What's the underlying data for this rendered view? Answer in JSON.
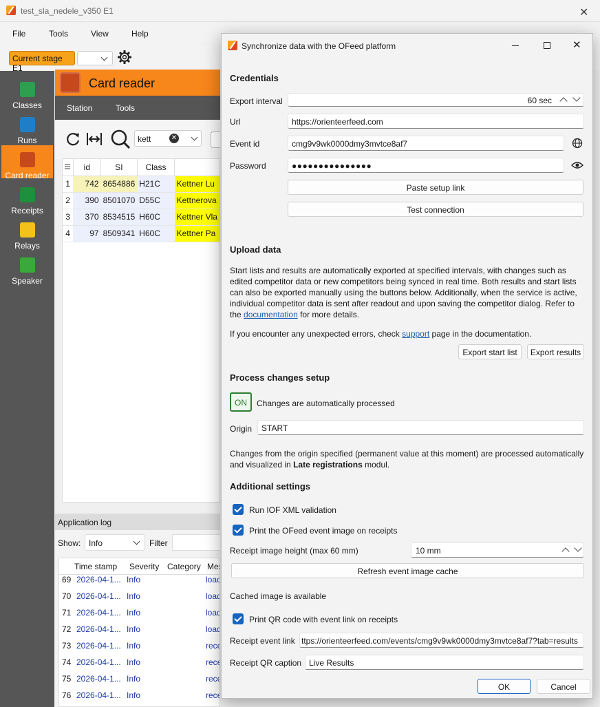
{
  "window": {
    "title": "test_sla_nedele_v350 E1"
  },
  "menu": {
    "file": "File",
    "tools": "Tools",
    "view": "View",
    "help": "Help"
  },
  "toolbar": {
    "stage_label": "Current stage E1"
  },
  "sidebar": {
    "items": [
      {
        "label": "Classes",
        "icon": "table-icon",
        "color": "#2e9e4f"
      },
      {
        "label": "Runs",
        "icon": "runner-icon",
        "color": "#1e7fc8"
      },
      {
        "label": "Card reader",
        "icon": "card-reader-icon",
        "color": "#c6491d"
      },
      {
        "label": "Receipts",
        "icon": "printer-icon",
        "color": "#1e8f3a"
      },
      {
        "label": "Relays",
        "icon": "relay-icon",
        "color": "#f2c11b"
      },
      {
        "label": "Speaker",
        "icon": "microphone-icon",
        "color": "#3aa83a"
      }
    ]
  },
  "card_reader": {
    "title": "Card reader",
    "tabs": {
      "station": "Station",
      "tools": "Tools"
    },
    "search_value": "kett",
    "columns": {
      "id": "id",
      "si": "SI",
      "class": "Class"
    },
    "rows": [
      {
        "n": "1",
        "id": "742",
        "si": "8654886",
        "class": "H21C",
        "name": "Kettner Lu"
      },
      {
        "n": "2",
        "id": "390",
        "si": "8501070",
        "class": "D55C",
        "name": "Kettnerova"
      },
      {
        "n": "3",
        "id": "370",
        "si": "8534515",
        "class": "H60C",
        "name": "Kettner Vla"
      },
      {
        "n": "4",
        "id": "97",
        "si": "8509341",
        "class": "H60C",
        "name": "Kettner Pa"
      }
    ]
  },
  "app_log": {
    "title": "Application log",
    "show_label": "Show:",
    "show_value": "Info",
    "filter_label": "Filter",
    "columns": {
      "time": "Time stamp",
      "severity": "Severity",
      "category": "Category",
      "message": "Mes"
    },
    "rows": [
      {
        "n": "69",
        "time": "2026-04-1...",
        "severity": "Info",
        "msg": "load"
      },
      {
        "n": "70",
        "time": "2026-04-1...",
        "severity": "Info",
        "msg": "load"
      },
      {
        "n": "71",
        "time": "2026-04-1...",
        "severity": "Info",
        "msg": "load"
      },
      {
        "n": "72",
        "time": "2026-04-1...",
        "severity": "Info",
        "msg": "load"
      },
      {
        "n": "73",
        "time": "2026-04-1...",
        "severity": "Info",
        "msg": "rece"
      },
      {
        "n": "74",
        "time": "2026-04-1...",
        "severity": "Info",
        "msg": "rece"
      },
      {
        "n": "75",
        "time": "2026-04-1...",
        "severity": "Info",
        "msg": "rece"
      },
      {
        "n": "76",
        "time": "2026-04-1...",
        "severity": "Info",
        "msg": "rece"
      }
    ]
  },
  "dialog": {
    "title": "Synchronize data with the OFeed platform",
    "credentials": {
      "heading": "Credentials",
      "export_interval_label": "Export interval",
      "export_interval_value": "60 sec",
      "url_label": "Url",
      "url_value": "https://orienteerfeed.com",
      "event_id_label": "Event id",
      "event_id_value": "cmg9v9wk0000dmy3mvtce8af7",
      "password_label": "Password",
      "password_value": "●●●●●●●●●●●●●●●",
      "paste_button": "Paste setup link",
      "test_button": "Test connection"
    },
    "upload": {
      "heading": "Upload data",
      "para1": "Start lists and results are automatically exported at specified intervals, with changes such as edited competitor data or new competitors being synced in real time. Both results and start lists can also be exported manually using the buttons below. Additionally, when the service is active, individual competitor data is sent after readout and upon saving the competitor dialog. Refer to the ",
      "para1_link": "documentation",
      "para1_end": " for more details.",
      "para2": "If you encounter any unexpected errors, check ",
      "para2_link": "support",
      "para2_end": " page in the documentation.",
      "export_start_button": "Export start list",
      "export_results_button": "Export results"
    },
    "process": {
      "heading": "Process changes setup",
      "toggle": "ON",
      "toggle_label": "Changes are automatically processed",
      "origin_label": "Origin",
      "origin_value": "START",
      "para": "Changes from the origin specified (permanent value at this moment) are processed automatically and visualized in ",
      "para_bold": "Late registrations",
      "para_end": " modul."
    },
    "additional": {
      "heading": "Additional settings",
      "iof_validation": "Run IOF XML validation",
      "print_image": "Print the OFeed event image on receipts",
      "image_height_label": "Receipt image height (max 60 mm)",
      "image_height_value": "10 mm",
      "refresh_button": "Refresh event image cache",
      "cached_status": "Cached image is available",
      "print_qr": "Print QR code with event link on receipts",
      "event_link_label": "Receipt event link",
      "event_link_value": "ttps://orienteerfeed.com/events/cmg9v9wk0000dmy3mvtce8af7?tab=results",
      "qr_caption_label": "Receipt QR caption",
      "qr_caption_value": "Live Results"
    },
    "ok_button": "OK",
    "cancel_button": "Cancel"
  },
  "colors": {
    "accent": "#f7861b",
    "sidebar": "#565656",
    "link": "#1a5fb4",
    "check": "#1565c0",
    "toggle_green": "#2e7d32"
  }
}
